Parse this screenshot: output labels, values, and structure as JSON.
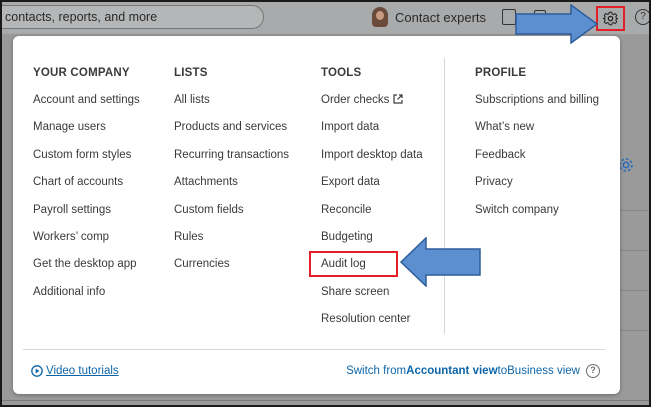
{
  "topbar": {
    "search_text": "contacts, reports, and more",
    "contact_experts": "Contact experts",
    "help_glyph": "?"
  },
  "menu": {
    "columns": [
      {
        "heading": "YOUR COMPANY",
        "items": [
          "Account and settings",
          "Manage users",
          "Custom form styles",
          "Chart of accounts",
          "Payroll settings",
          "Workers’ comp",
          "Get the desktop app",
          "Additional info"
        ]
      },
      {
        "heading": "LISTS",
        "items": [
          "All lists",
          "Products and services",
          "Recurring transactions",
          "Attachments",
          "Custom fields",
          "Rules",
          "Currencies"
        ]
      },
      {
        "heading": "TOOLS",
        "items": [
          "Order checks",
          "Import data",
          "Import desktop data",
          "Export data",
          "Reconcile",
          "Budgeting",
          "Audit log",
          "Share screen",
          "Resolution center"
        ]
      },
      {
        "heading": "PROFILE",
        "items": [
          "Subscriptions and billing",
          "What’s new",
          "Feedback",
          "Privacy",
          "Switch company"
        ]
      }
    ],
    "footer": {
      "video_tutorials": "Video tutorials",
      "switch_prefix": "Switch from ",
      "switch_bold": "Accountant view",
      "switch_middle": " to ",
      "switch_target": "Business view",
      "help_glyph": "?"
    }
  },
  "colors": {
    "accent_blue": "#0d65a7",
    "highlight_red": "#e41e26",
    "arrow_blue": "#5b8fd0",
    "text_dark": "#393a3d"
  },
  "icons": [
    "search-field",
    "avatar",
    "clipboard-icon",
    "gift-icon",
    "gear-icon",
    "help-icon",
    "external-link-icon",
    "play-circle-icon",
    "question-circle-icon"
  ]
}
